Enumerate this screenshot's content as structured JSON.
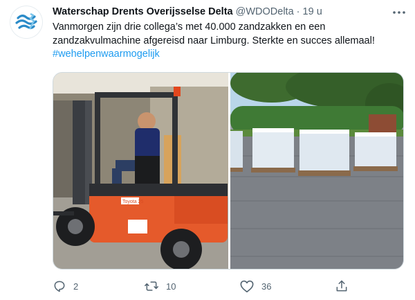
{
  "tweet": {
    "author_name": "Waterschap Drents Overijsselse Delta",
    "author_handle": "@WDODelta",
    "separator": "·",
    "time": "19 u",
    "text_main": "Vanmorgen zijn drie collega’s met 40.000 zandzakken en een zandzakvulmachine afgereisd naar Limburg. Sterkte en succes allemaal!",
    "hashtag": "#wehelpenwaarmogelijk",
    "avatar_icon": "wdo-logo-icon",
    "more_icon": "more-dots-icon",
    "brand_color": "#2b8bc8",
    "hashtag_color": "#1d9bf0"
  },
  "media": {
    "left_image": "forklift-photo",
    "right_image": "sandbag-pallets-photo",
    "forklift_text": "Toyota 25"
  },
  "actions": {
    "reply_count": "2",
    "retweet_count": "10",
    "like_count": "36",
    "reply_icon": "reply-icon",
    "retweet_icon": "retweet-icon",
    "like_icon": "heart-icon",
    "share_icon": "share-icon"
  }
}
